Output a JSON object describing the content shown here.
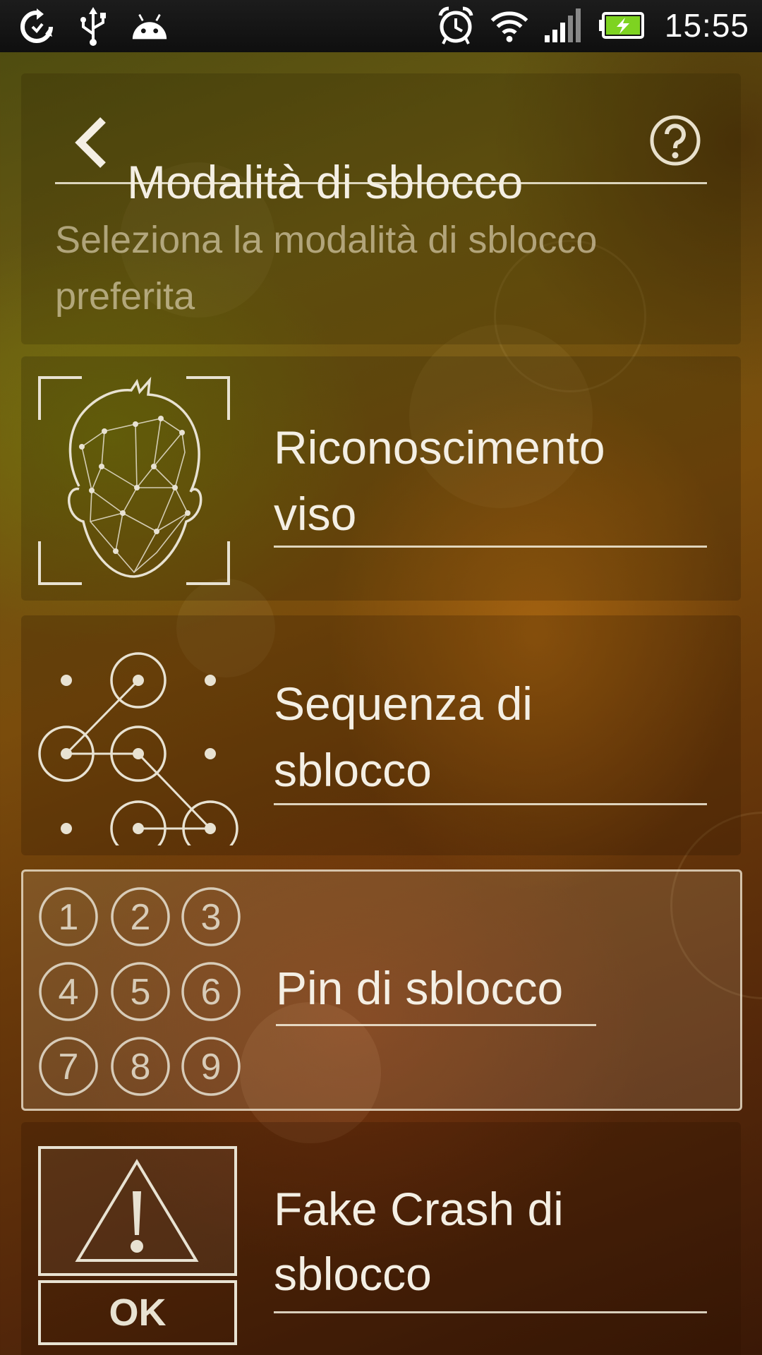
{
  "status_bar": {
    "time": "15:55",
    "left_icons": [
      "sync-icon",
      "usb-icon",
      "android-debug-icon"
    ],
    "right_icons": [
      "alarm-icon",
      "wifi-icon",
      "signal-icon",
      "battery-charging-icon"
    ]
  },
  "header": {
    "title": "Modalità di sblocco",
    "subtitle": "Seleziona la modalità di sblocco preferita",
    "back_icon": "chevron-left-icon",
    "help_icon": "help-icon"
  },
  "options": [
    {
      "label_line1": "Riconoscimento",
      "label_line2": "viso",
      "icon": "face-recognition-icon"
    },
    {
      "label_line1": "Sequenza di",
      "label_line2": "sblocco",
      "icon": "pattern-lock-icon"
    },
    {
      "label_line1": "Pin di sblocco",
      "icon": "pin-keypad-icon",
      "selected": true,
      "keys": [
        "1",
        "2",
        "3",
        "4",
        "5",
        "6",
        "7",
        "8",
        "9"
      ]
    },
    {
      "label_line1": "Fake Crash di",
      "label_line2": "sblocco",
      "icon": "warning-icon",
      "ok_label": "OK"
    }
  ],
  "colors": {
    "text": "#f4efe4",
    "subtitle": "#e6dcbe",
    "statusbar": "#151515",
    "battery": "#7ed321"
  }
}
